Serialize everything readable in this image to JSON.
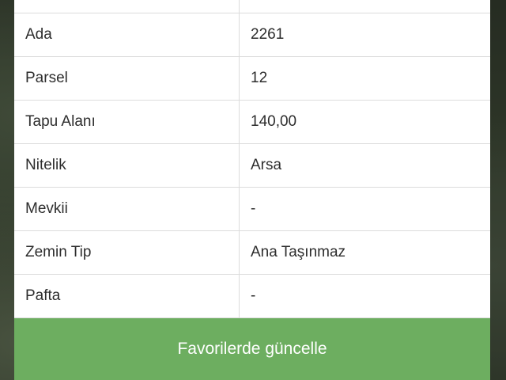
{
  "parcel_info": {
    "rows": [
      {
        "label": "",
        "value": ""
      },
      {
        "label": "Ada",
        "value": "2261"
      },
      {
        "label": "Parsel",
        "value": "12"
      },
      {
        "label": "Tapu Alanı",
        "value": "140,00"
      },
      {
        "label": "Nitelik",
        "value": "Arsa"
      },
      {
        "label": "Mevkii",
        "value": "-"
      },
      {
        "label": "Zemin Tip",
        "value": "Ana Taşınmaz"
      },
      {
        "label": "Pafta",
        "value": "-"
      }
    ]
  },
  "actions": {
    "update_favorites_label": "Favorilerde güncelle"
  },
  "colors": {
    "button_green": "#6dae60",
    "border": "#dcdcdc",
    "text": "#2d2d2d"
  }
}
